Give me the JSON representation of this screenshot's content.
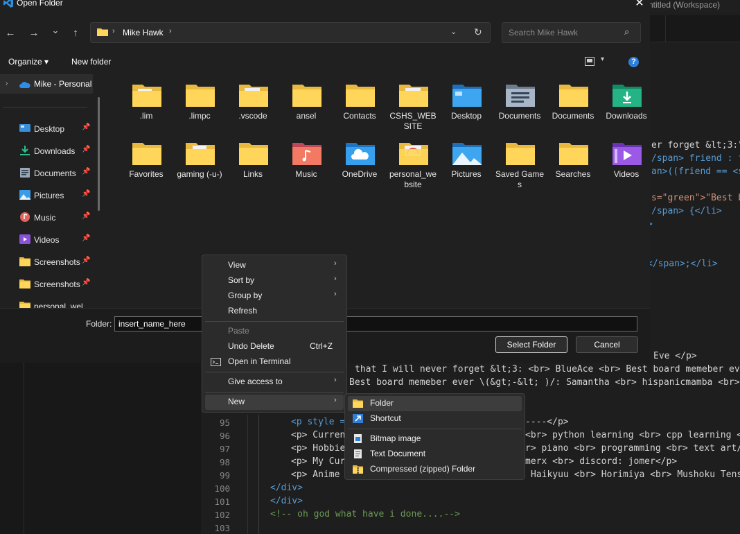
{
  "window": {
    "vscode_title": "ntitled (Workspace)",
    "dialog_title": "Open Folder",
    "close_glyph": "✕"
  },
  "navigation": {
    "back": "←",
    "forward": "→",
    "recent": "⌄",
    "up": "↑"
  },
  "address": {
    "separator": "›",
    "location": "Mike Hawk",
    "dropdown": "⌄",
    "refresh": "↻"
  },
  "search": {
    "placeholder": "Search Mike Hawk",
    "icon": "⌕"
  },
  "toolbar": {
    "organize": "Organize ▾",
    "new_folder": "New folder",
    "view_dropdown": "▾",
    "help": "?"
  },
  "nav_pane": {
    "root": {
      "label": "Mike - Personal",
      "icon": "onedrive-cloud-icon"
    },
    "pin_glyph": "📌",
    "items": [
      {
        "label": "Desktop",
        "icon": "desktop-icon"
      },
      {
        "label": "Downloads",
        "icon": "downloads-icon"
      },
      {
        "label": "Documents",
        "icon": "documents-icon"
      },
      {
        "label": "Pictures",
        "icon": "pictures-icon"
      },
      {
        "label": "Music",
        "icon": "music-icon"
      },
      {
        "label": "Videos",
        "icon": "videos-icon"
      },
      {
        "label": "Screenshots",
        "icon": "folder-icon"
      },
      {
        "label": "Screenshots",
        "icon": "folder-icon"
      },
      {
        "label": "personal_wel",
        "icon": "folder-icon"
      }
    ]
  },
  "files": [
    {
      "label": ".lim",
      "icon": "folder-with-files-icon"
    },
    {
      "label": ".limpc",
      "icon": "folder-icon"
    },
    {
      "label": ".vscode",
      "icon": "folder-with-files-icon"
    },
    {
      "label": "ansel",
      "icon": "folder-icon"
    },
    {
      "label": "Contacts",
      "icon": "folder-icon"
    },
    {
      "label": "CSHS_WEBSITE",
      "icon": "folder-with-files-icon"
    },
    {
      "label": "Desktop",
      "icon": "desktop-folder-icon"
    },
    {
      "label": "Documents",
      "icon": "documents-folder-icon"
    },
    {
      "label": "Documents",
      "icon": "folder-icon"
    },
    {
      "label": "Downloads",
      "icon": "downloads-folder-icon"
    },
    {
      "label": "Favorites",
      "icon": "folder-icon"
    },
    {
      "label": "gaming (-u-)",
      "icon": "folder-with-files-icon"
    },
    {
      "label": "Links",
      "icon": "folder-icon"
    },
    {
      "label": "Music",
      "icon": "music-folder-icon"
    },
    {
      "label": "OneDrive",
      "icon": "onedrive-folder-icon"
    },
    {
      "label": "personal_website",
      "icon": "folder-with-files-icon"
    },
    {
      "label": "Pictures",
      "icon": "pictures-folder-icon"
    },
    {
      "label": "Saved Games",
      "icon": "folder-icon"
    },
    {
      "label": "Searches",
      "icon": "folder-icon"
    },
    {
      "label": "Videos",
      "icon": "videos-folder-icon"
    }
  ],
  "bottom": {
    "folder_label": "Folder:",
    "folder_value": "insert_name_here",
    "select_button": "Select Folder",
    "cancel_button": "Cancel"
  },
  "context_menu": {
    "submenu_arrow": "›",
    "items": [
      {
        "label": "View",
        "submenu": true
      },
      {
        "label": "Sort by",
        "submenu": true
      },
      {
        "label": "Group by",
        "submenu": true
      },
      {
        "label": "Refresh"
      },
      {
        "label": "Paste",
        "disabled": true
      },
      {
        "label": "Undo Delete",
        "shortcut": "Ctrl+Z"
      },
      {
        "label": "Open in Terminal",
        "icon": "terminal-icon"
      },
      {
        "label": "Give access to",
        "submenu": true
      },
      {
        "label": "New",
        "submenu": true
      }
    ]
  },
  "new_submenu": {
    "items": [
      {
        "label": "Folder",
        "icon": "folder-icon"
      },
      {
        "label": "Shortcut",
        "icon": "shortcut-icon"
      },
      {
        "label": "Bitmap image",
        "icon": "bitmap-icon"
      },
      {
        "label": "Text Document",
        "icon": "text-document-icon"
      },
      {
        "label": "Compressed (zipped) Folder",
        "icon": "zip-folder-icon"
      }
    ]
  },
  "editor": {
    "right_lines": [
      "er forget &lt;3:\"",
      "/span> friend : f",
      "an>((friend == <sp",
      "s=\"green\">\"Best b",
      "/span> {</li>",
      ">",
      "</span>;</li>"
    ],
    "line_eve": "Eve </p>",
    "line_a": "that I will never forget &lt;3: <br> BlueAce <br> Best board memeber ever",
    "line_b": "Best board memeber ever \\(&gt;-&lt; )/: Samantha <br> hispanicmamba <br> s",
    "line_numbers": [
      "95",
      "96",
      "97",
      "98",
      "99",
      "100",
      "101",
      "102",
      "103"
    ],
    "code_95_a": "<p style =",
    "code_95_b": "----</p>",
    "code_96_a": "<p> Curren",
    "code_96_b": "<br> python learning <br> cpp learning <",
    "code_97_a": "<p> Hobbie",
    "code_97_b": "r> piano <br> programming <br> text art/",
    "code_98_a": "<p> My Cur",
    "code_98_b": "merx <br> discord: jomer</p>",
    "code_99_a": "<p> Anime",
    "code_99_b": "Haikyuu <br> Horimiya <br> Mushoku Tens",
    "code_100": "</div>",
    "code_101": "</div>",
    "code_102": "<!-- oh god what have i done....-->"
  }
}
